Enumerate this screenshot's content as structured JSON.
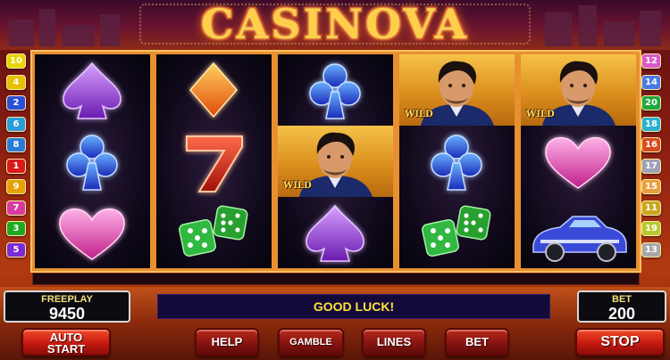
{
  "game": {
    "title": "CASINOVA"
  },
  "paylines": {
    "left": [
      {
        "label": "10",
        "color": "#e8d400"
      },
      {
        "label": "4",
        "color": "#e8c000"
      },
      {
        "label": "2",
        "color": "#2a50d8"
      },
      {
        "label": "6",
        "color": "#2a9ad8"
      },
      {
        "label": "8",
        "color": "#2a7ad8"
      },
      {
        "label": "1",
        "color": "#d81a1a"
      },
      {
        "label": "9",
        "color": "#e8a000"
      },
      {
        "label": "7",
        "color": "#d83aa0"
      },
      {
        "label": "3",
        "color": "#20a820"
      },
      {
        "label": "5",
        "color": "#7a2ad8"
      }
    ],
    "right": [
      {
        "label": "12",
        "color": "#d85ac8"
      },
      {
        "label": "14",
        "color": "#4a7ae8"
      },
      {
        "label": "20",
        "color": "#20a840"
      },
      {
        "label": "18",
        "color": "#2ab0d0"
      },
      {
        "label": "16",
        "color": "#d84a20"
      },
      {
        "label": "17",
        "color": "#a0a0b8"
      },
      {
        "label": "15",
        "color": "#e8a040"
      },
      {
        "label": "11",
        "color": "#c8a820"
      },
      {
        "label": "19",
        "color": "#b8c830"
      },
      {
        "label": "13",
        "color": "#a8a8a8"
      }
    ]
  },
  "reels": [
    {
      "symbols": [
        "spade",
        "club",
        "heart"
      ]
    },
    {
      "symbols": [
        "diamond",
        "seven",
        "dice"
      ]
    },
    {
      "symbols": [
        "club",
        "wild",
        "spade"
      ]
    },
    {
      "symbols": [
        "wild",
        "club",
        "dice"
      ]
    },
    {
      "symbols": [
        "wild",
        "heart",
        "car"
      ]
    }
  ],
  "wild_label": "WILD",
  "freeplay": {
    "label": "FREEPLAY",
    "value": "9450"
  },
  "bet": {
    "label": "BET",
    "value": "200"
  },
  "message": "GOOD LUCK!",
  "buttons": {
    "auto_start_line1": "AUTO",
    "auto_start_line2": "START",
    "help": "HELP",
    "gamble": "GAMBLE",
    "lines": "LINES",
    "bet": "BET",
    "stop": "STOP"
  },
  "colors": {
    "accent_gold": "#ffcf4a",
    "message_text": "#ffe43a",
    "button_red": "#c61a10"
  }
}
